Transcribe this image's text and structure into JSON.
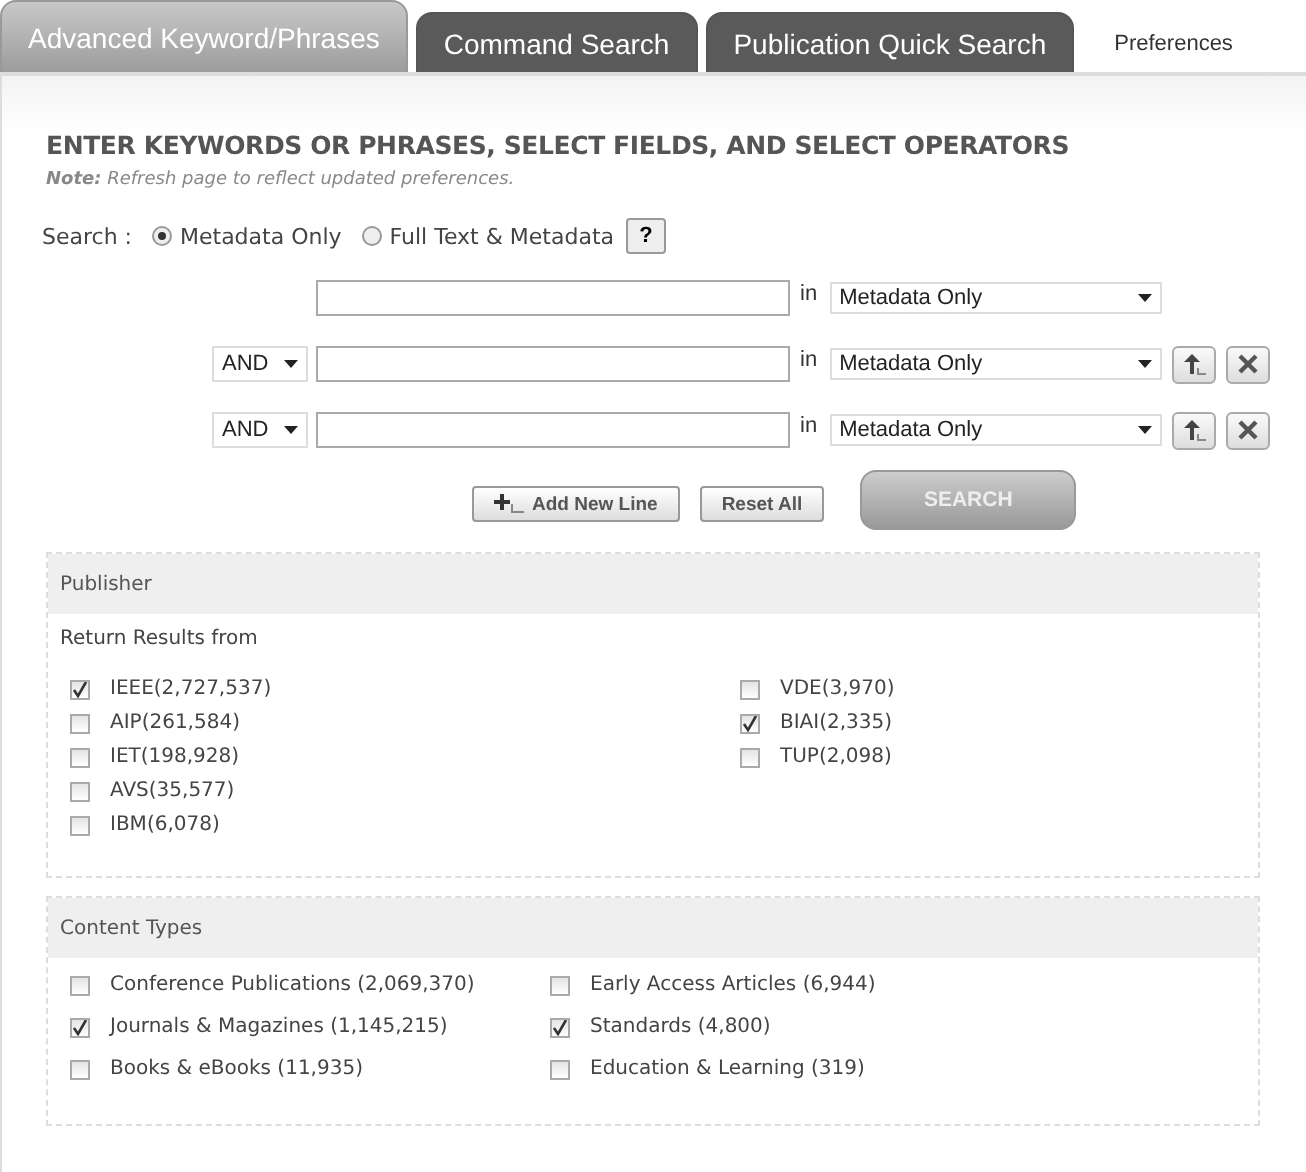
{
  "tabs": [
    {
      "label": "Advanced Keyword/Phrases",
      "selected": true,
      "kind": "tab"
    },
    {
      "label": "Command Search",
      "selected": false,
      "kind": "tab"
    },
    {
      "label": "Publication Quick Search",
      "selected": false,
      "kind": "tab"
    },
    {
      "label": "Preferences",
      "selected": false,
      "kind": "link"
    }
  ],
  "heading": "ENTER KEYWORDS OR PHRASES, SELECT FIELDS, AND SELECT OPERATORS",
  "note": "**Note:** Refresh page to reflect updated preferences.",
  "search_scope": {
    "label": "Search :",
    "options": [
      {
        "label": "Metadata Only",
        "selected": true
      },
      {
        "label": "Full Text & Metadata",
        "selected": false
      }
    ],
    "help": "?"
  },
  "query_rows": [
    {
      "field": "Metadata Only",
      "in": "in"
    },
    {
      "operator": "AND",
      "field": "Metadata Only",
      "in": "in",
      "removable": true
    },
    {
      "operator": "AND",
      "field": "Metadata Only",
      "in": "in",
      "removable": true
    }
  ],
  "buttons": {
    "add": "Add New Line",
    "reset": "Reset All",
    "search": "SEARCH"
  },
  "publisher": {
    "title": "Publisher",
    "subtitle": "Return Results from",
    "columns": [
      [
        {
          "label": "IEEE(2,727,537)",
          "checked": true
        },
        {
          "label": "AIP(261,584)",
          "checked": false
        },
        {
          "label": "IET(198,928)",
          "checked": false
        },
        {
          "label": "AVS(35,577)",
          "checked": false
        },
        {
          "label": "IBM(6,078)",
          "checked": false
        }
      ],
      [
        {
          "label": "VDE(3,970)",
          "checked": false
        },
        {
          "label": "BIAI(2,335)",
          "checked": true
        },
        {
          "label": "TUP(2,098)",
          "checked": false
        }
      ]
    ]
  },
  "content_types": {
    "title": "Content Types",
    "columns": [
      [
        {
          "label": "Conference Publications (2,069,370)",
          "checked": false
        },
        {
          "label": "Journals & Magazines (1,145,215)",
          "checked": true
        },
        {
          "label": "Books & eBooks (11,935)",
          "checked": false
        }
      ],
      [
        {
          "label": "Early Access Articles (6,944)",
          "checked": false
        },
        {
          "label": "Standards (4,800)",
          "checked": true
        },
        {
          "label": "Education & Learning (319)",
          "checked": false
        }
      ]
    ]
  }
}
